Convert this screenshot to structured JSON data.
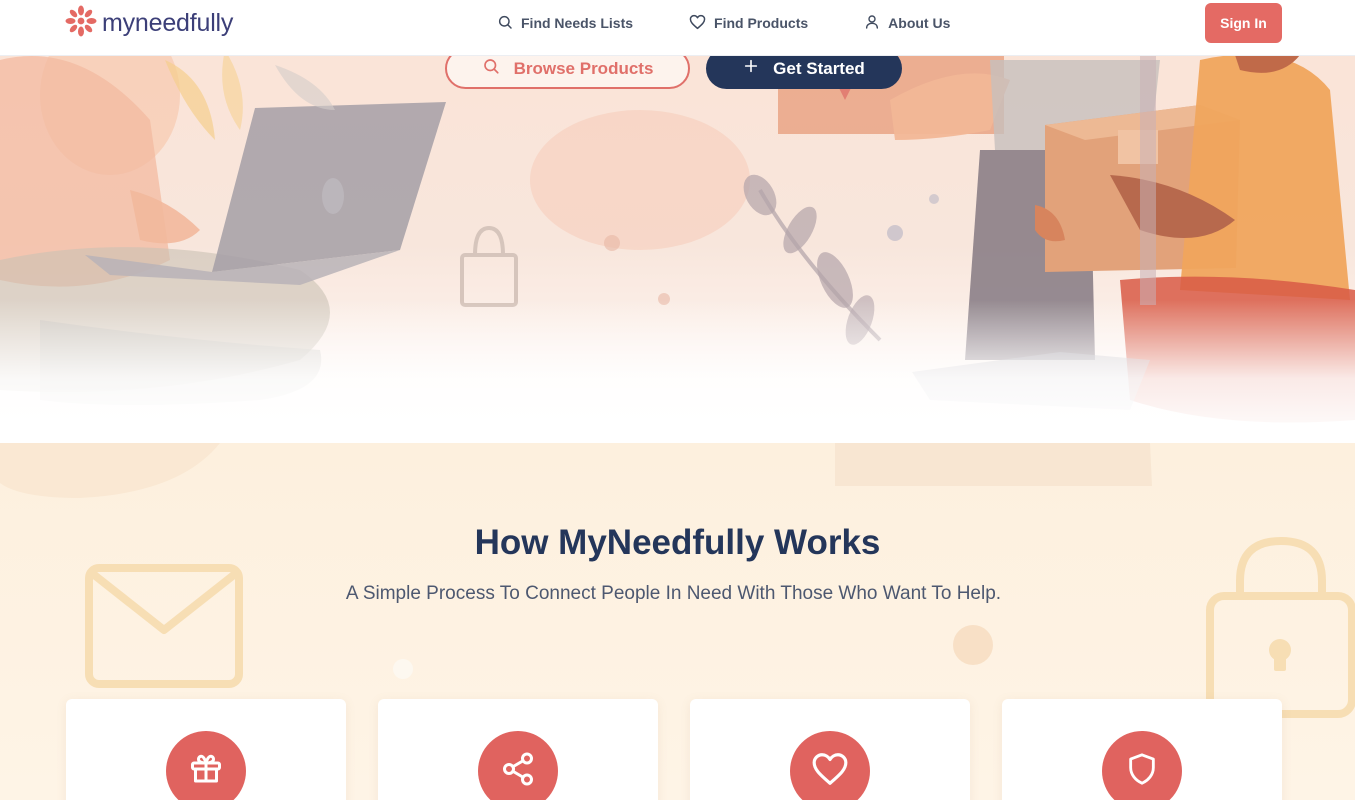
{
  "brand": {
    "name": "myneedfully",
    "accent": "#e46a64",
    "navy": "#24365a"
  },
  "nav": {
    "links": [
      {
        "label": "Find Needs Lists",
        "icon": "search-icon"
      },
      {
        "label": "Find Products",
        "icon": "heart-icon"
      },
      {
        "label": "About Us",
        "icon": "user-icon"
      }
    ],
    "sign_in": "Sign In"
  },
  "hero": {
    "browse_label": "Browse Products",
    "start_label": "Get Started"
  },
  "how": {
    "title": "How MyNeedfully Works",
    "subtitle": "A Simple Process To Connect People In Need With Those Who Want To Help.",
    "cards": [
      {
        "icon": "gift-icon"
      },
      {
        "icon": "share-icon"
      },
      {
        "icon": "heart-icon"
      },
      {
        "icon": "shield-icon"
      }
    ]
  }
}
